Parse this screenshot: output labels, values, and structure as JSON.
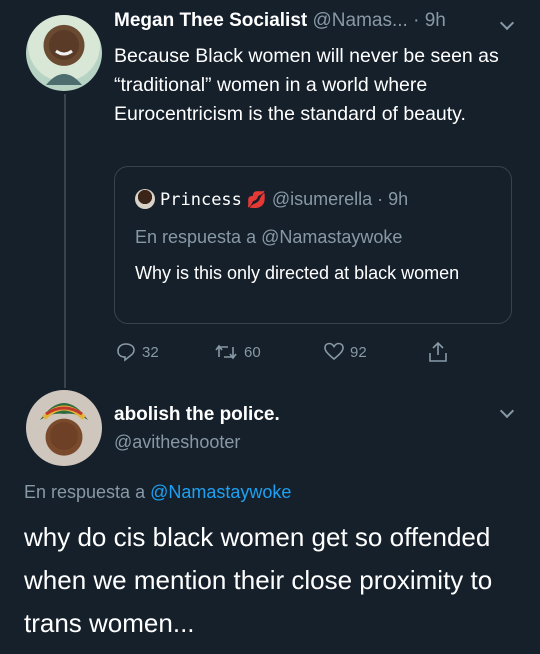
{
  "tweet1": {
    "display_name": "Megan Thee Socialist",
    "handle_time": "@Namas... · 9h",
    "text": "Because Black women will never be seen as “traditional” women in a world where Eurocentricism is the standard of beauty.",
    "quoted": {
      "display_name": "Princess",
      "emoji": "💋",
      "handle_time": "@isumerella · 9h",
      "reply_prefix": "En respuesta a ",
      "reply_handle": "@Namastaywoke",
      "text": "Why is this only directed at black women"
    },
    "actions": {
      "replies": "32",
      "retweets": "60",
      "likes": "92"
    }
  },
  "tweet2": {
    "display_name": "abolish the police.",
    "handle": "@avitheshooter",
    "reply_prefix": "En respuesta a ",
    "reply_handle": "@Namastaywoke",
    "text": "why do cis black women get so offended when we mention their close proximity to trans women..."
  },
  "colors": {
    "background": "#15202b",
    "muted": "#8899a6",
    "link": "#1da1f2",
    "border": "#38444d"
  }
}
